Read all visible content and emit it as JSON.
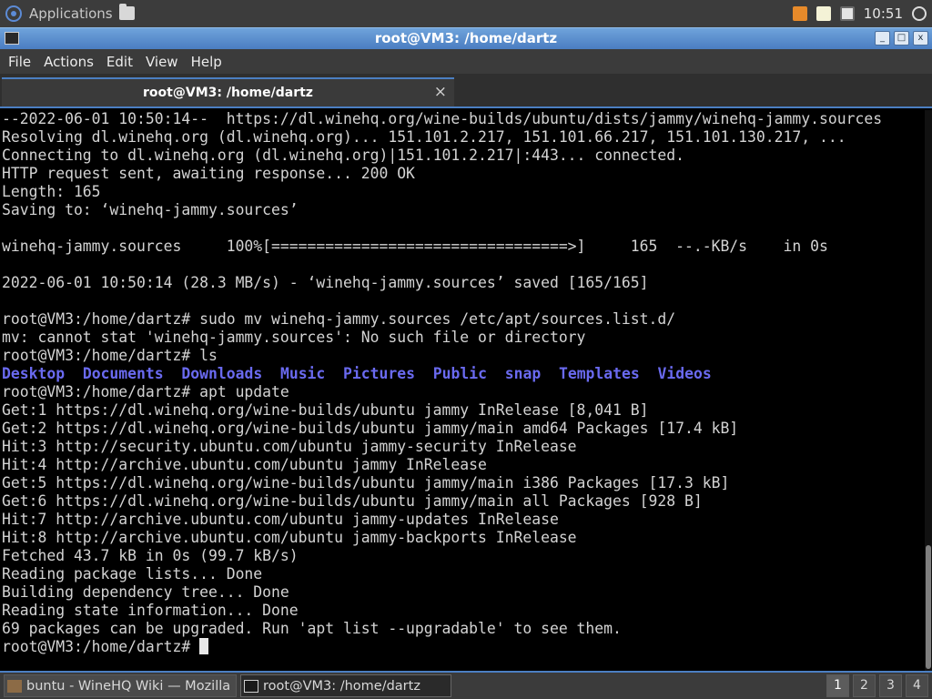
{
  "top_panel": {
    "applications_label": "Applications",
    "clock": "10:51"
  },
  "window": {
    "title": "root@VM3: /home/dartz",
    "buttons": [
      "_",
      "□",
      "x"
    ]
  },
  "menu": [
    "File",
    "Actions",
    "Edit",
    "View",
    "Help"
  ],
  "tab": {
    "label": "root@VM3: /home/dartz",
    "close": "×"
  },
  "terminal": {
    "lines": [
      "--2022-06-01 10:50:14--  https://dl.winehq.org/wine-builds/ubuntu/dists/jammy/winehq-jammy.sources",
      "Resolving dl.winehq.org (dl.winehq.org)... 151.101.2.217, 151.101.66.217, 151.101.130.217, ...",
      "Connecting to dl.winehq.org (dl.winehq.org)|151.101.2.217|:443... connected.",
      "HTTP request sent, awaiting response... 200 OK",
      "Length: 165",
      "Saving to: ‘winehq-jammy.sources’",
      "",
      "winehq-jammy.sources     100%[=================================>]     165  --.-KB/s    in 0s",
      "",
      "2022-06-01 10:50:14 (28.3 MB/s) - ‘winehq-jammy.sources’ saved [165/165]",
      "",
      "root@VM3:/home/dartz# sudo mv winehq-jammy.sources /etc/apt/sources.list.d/",
      "mv: cannot stat 'winehq-jammy.sources': No such file or directory",
      "root@VM3:/home/dartz# ls"
    ],
    "ls_dirs": [
      "Desktop",
      "Documents",
      "Downloads",
      "Music",
      "Pictures",
      "Public",
      "snap",
      "Templates",
      "Videos"
    ],
    "lines_after": [
      "root@VM3:/home/dartz# apt update",
      "Get:1 https://dl.winehq.org/wine-builds/ubuntu jammy InRelease [8,041 B]",
      "Get:2 https://dl.winehq.org/wine-builds/ubuntu jammy/main amd64 Packages [17.4 kB]",
      "Hit:3 http://security.ubuntu.com/ubuntu jammy-security InRelease",
      "Hit:4 http://archive.ubuntu.com/ubuntu jammy InRelease",
      "Get:5 https://dl.winehq.org/wine-builds/ubuntu jammy/main i386 Packages [17.3 kB]",
      "Get:6 https://dl.winehq.org/wine-builds/ubuntu jammy/main all Packages [928 B]",
      "Hit:7 http://archive.ubuntu.com/ubuntu jammy-updates InRelease",
      "Hit:8 http://archive.ubuntu.com/ubuntu jammy-backports InRelease",
      "Fetched 43.7 kB in 0s (99.7 kB/s)",
      "Reading package lists... Done",
      "Building dependency tree... Done",
      "Reading state information... Done",
      "69 packages can be upgraded. Run 'apt list --upgradable' to see them."
    ],
    "prompt": "root@VM3:/home/dartz# "
  },
  "taskbar": {
    "tasks": [
      "buntu - WineHQ Wiki — Mozilla Firefox",
      "root@VM3: /home/dartz"
    ],
    "workspaces": [
      "1",
      "2",
      "3",
      "4"
    ]
  }
}
